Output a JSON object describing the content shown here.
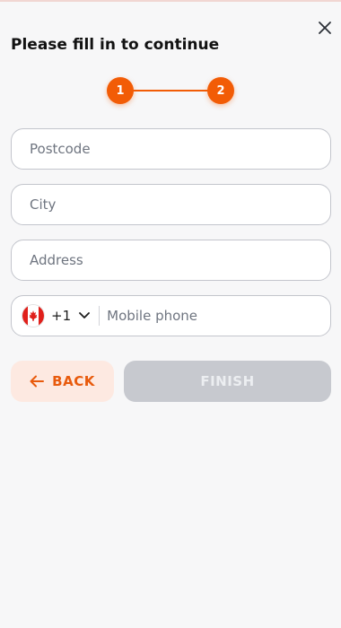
{
  "header": {
    "title": "Please fill in to continue",
    "close_icon": "close-icon"
  },
  "stepper": {
    "steps": [
      "1",
      "2"
    ],
    "active_color": "#f25c06"
  },
  "form": {
    "postcode": {
      "placeholder": "Postcode",
      "value": ""
    },
    "city": {
      "placeholder": "City",
      "value": ""
    },
    "address": {
      "placeholder": "Address",
      "value": ""
    },
    "phone": {
      "country_flag": "canada-flag-icon",
      "dial_code": "+1",
      "placeholder": "Mobile phone",
      "value": ""
    }
  },
  "actions": {
    "back_label": "BACK",
    "finish_label": "FINISH",
    "back_color": "#e85a0c",
    "finish_disabled": true
  }
}
